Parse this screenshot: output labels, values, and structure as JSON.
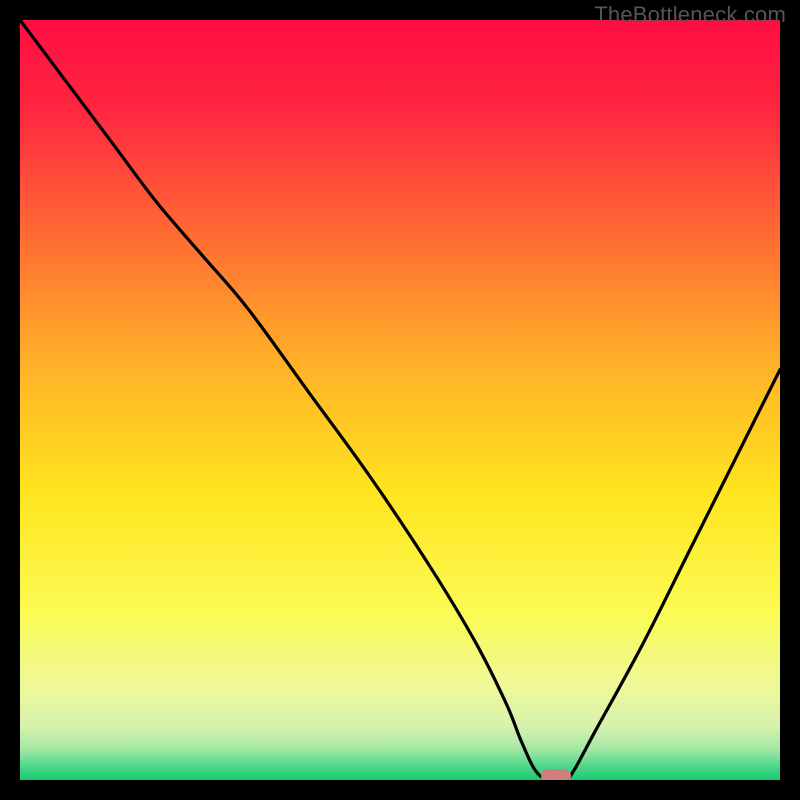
{
  "watermark": "TheBottleneck.com",
  "colors": {
    "marker": "#cf7e7e",
    "curve": "#000000",
    "frame": "#000000"
  },
  "chart_data": {
    "type": "line",
    "title": "",
    "xlabel": "",
    "ylabel": "",
    "xlim": [
      0,
      100
    ],
    "ylim": [
      0,
      100
    ],
    "grid": false,
    "legend": {
      "show": false
    },
    "series": [
      {
        "name": "curve",
        "x": [
          0,
          6,
          12,
          18,
          24,
          30,
          38,
          46,
          54,
          60,
          64,
          66,
          68,
          70,
          72,
          76,
          82,
          88,
          94,
          100
        ],
        "y": [
          100,
          92,
          84,
          76,
          69,
          62,
          51,
          40,
          28,
          18,
          10,
          5,
          1,
          0,
          0,
          7,
          18,
          30,
          42,
          54
        ]
      }
    ],
    "marker": {
      "x": 70.5,
      "y": 0.5
    },
    "gradient": [
      {
        "stop": 0,
        "color": "#ff0d42"
      },
      {
        "stop": 12,
        "color": "#ff2740"
      },
      {
        "stop": 28,
        "color": "#ff6a33"
      },
      {
        "stop": 45,
        "color": "#ffb028"
      },
      {
        "stop": 62,
        "color": "#ffe41e"
      },
      {
        "stop": 78,
        "color": "#fbfb54"
      },
      {
        "stop": 88,
        "color": "#eef89a"
      },
      {
        "stop": 93,
        "color": "#d5f2ae"
      },
      {
        "stop": 96,
        "color": "#a2e7a4"
      },
      {
        "stop": 98,
        "color": "#55d98d"
      },
      {
        "stop": 100,
        "color": "#18c96f"
      }
    ]
  }
}
